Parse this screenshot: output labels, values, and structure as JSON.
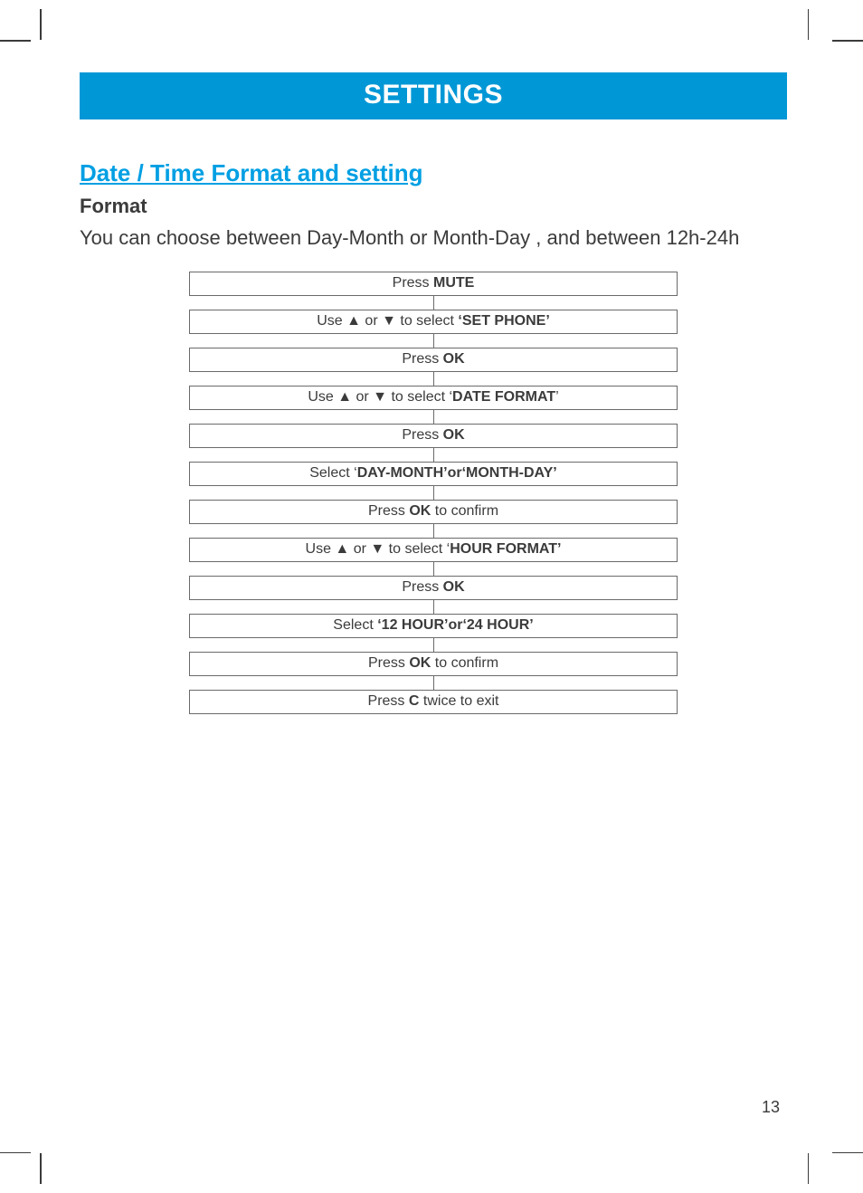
{
  "banner": "SETTINGS",
  "section_title": "Date / Time  Format and setting",
  "subsection": "Format",
  "intro": "You can choose between Day-Month or Month-Day , and between 12h-24h",
  "steps": [
    {
      "pre": "Press ",
      "bold": "MUTE",
      "post": ""
    },
    {
      "pre": "Use ▲ or ▼ to select ",
      "bold": "‘SET PHONE’",
      "post": ""
    },
    {
      "pre": "Press ",
      "bold": "OK",
      "post": ""
    },
    {
      "pre": "Use ▲ or ▼ to select ‘",
      "bold": "DATE FORMAT",
      "post": "’"
    },
    {
      "pre": "Press ",
      "bold": "OK",
      "post": ""
    },
    {
      "pre": "Select ‘",
      "bold": "DAY-MONTH’or‘MONTH-DAY’",
      "post": ""
    },
    {
      "pre": "Press ",
      "bold": "OK",
      "post": " to confirm"
    },
    {
      "pre": "Use ▲ or ▼ to select ‘",
      "bold": "HOUR FORMAT’",
      "post": ""
    },
    {
      "pre": "Press ",
      "bold": "OK",
      "post": ""
    },
    {
      "pre": "Select ",
      "bold": "‘12 HOUR’or‘24 HOUR’",
      "post": ""
    },
    {
      "pre": "Press ",
      "bold": "OK",
      "post": " to confirm"
    },
    {
      "pre": "Press ",
      "bold": "C",
      "post": " twice to exit"
    }
  ],
  "page_number": "13"
}
